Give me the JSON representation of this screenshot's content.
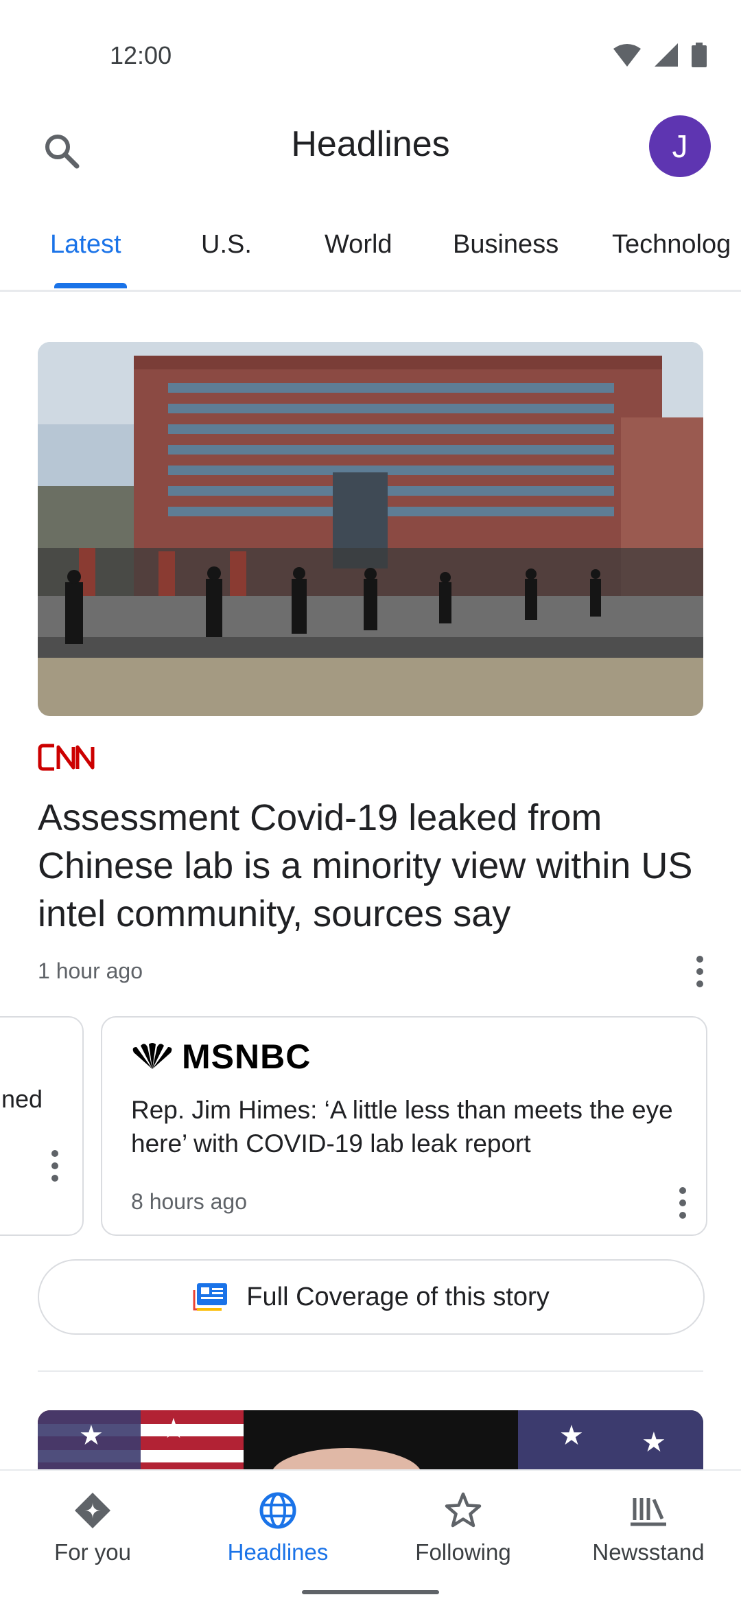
{
  "status_bar": {
    "time": "12:00"
  },
  "app_bar": {
    "title": "Headlines",
    "avatar_initial": "J"
  },
  "tabs": [
    {
      "label": "Latest",
      "active": true
    },
    {
      "label": "U.S."
    },
    {
      "label": "World"
    },
    {
      "label": "Business"
    },
    {
      "label": "Technolog"
    }
  ],
  "main_story": {
    "source": "CNN",
    "headline": "Assessment Covid-19 leaked from Chinese lab is a minority view within US intel community, sources say",
    "time": "1 hour ago"
  },
  "related": {
    "left_card_snippet": "ned",
    "msnbc": {
      "source": "MSNBC",
      "title": "Rep. Jim Himes: ‘A little less than meets the eye here’ with COVID-19 lab leak report",
      "time": "8 hours ago"
    }
  },
  "full_coverage": {
    "label": "Full Coverage of this story"
  },
  "bottom_nav": {
    "items": [
      {
        "label": "For you",
        "icon": "for-you-icon"
      },
      {
        "label": "Headlines",
        "icon": "globe-icon",
        "active": true
      },
      {
        "label": "Following",
        "icon": "star-icon"
      },
      {
        "label": "Newsstand",
        "icon": "newsstand-icon"
      }
    ]
  },
  "colors": {
    "accent": "#1a73e8",
    "avatar": "#5e35b1",
    "cnn_red": "#cc0000"
  }
}
